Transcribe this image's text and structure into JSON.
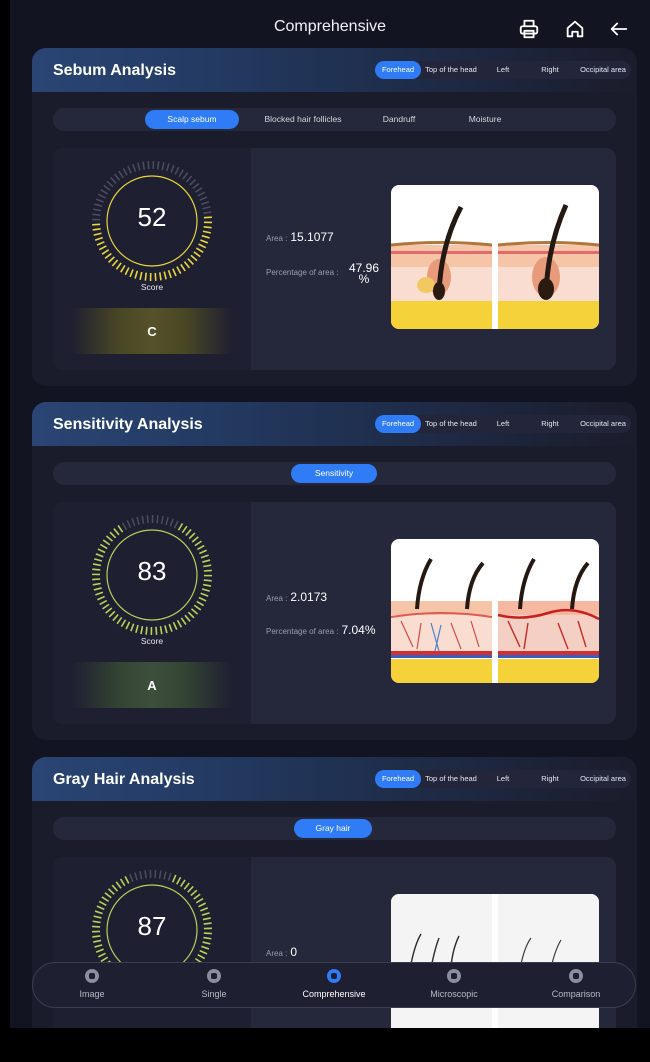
{
  "header": {
    "title": "Comprehensive",
    "print_icon": "printer-icon",
    "home_icon": "home-icon",
    "back_icon": "arrow-left-icon"
  },
  "region_tabs": [
    "Forehead",
    "Top of the head",
    "Left",
    "Right",
    "Occipital area"
  ],
  "sebum": {
    "title": "Sebum Analysis",
    "selected_region": "Forehead",
    "sub_tabs": [
      "Scalp sebum",
      "Blocked hair follicles",
      "Dandruff",
      "Moisture"
    ],
    "selected_sub_tab": "Scalp sebum",
    "score": "52",
    "score_label": "Score",
    "grade": "C",
    "area_label": "Area :",
    "area_value": "15.1077",
    "percent_label": "Percentage of area :",
    "percent_value": "47.96 %"
  },
  "sensitivity": {
    "title": "Sensitivity Analysis",
    "selected_region": "Forehead",
    "sub_tabs": [
      "Sensitivity"
    ],
    "selected_sub_tab": "Sensitivity",
    "score": "83",
    "score_label": "Score",
    "grade": "A",
    "area_label": "Area :",
    "area_value": "2.0173",
    "percent_label": "Percentage of area :",
    "percent_value": "7.04%"
  },
  "gray_hair": {
    "title": "Gray Hair Analysis",
    "selected_region": "Forehead",
    "sub_tabs": [
      "Gray hair"
    ],
    "selected_sub_tab": "Gray hair",
    "score": "87",
    "area_label": "Area :",
    "area_value": "0"
  },
  "colors": {
    "accent": "#2f7cf6",
    "background": "#131422",
    "card": "#1b1c2b",
    "gauge_yellow": "#e8d640",
    "gauge_green": "#b6d35a"
  },
  "bottom_nav": {
    "active": "Comprehensive",
    "items": [
      {
        "label": "Image",
        "icon": "image-icon"
      },
      {
        "label": "Single",
        "icon": "single-icon"
      },
      {
        "label": "Comprehensive",
        "icon": "comprehensive-icon"
      },
      {
        "label": "Microscopic",
        "icon": "microscope-icon"
      },
      {
        "label": "Comparison",
        "icon": "comparison-icon"
      }
    ]
  }
}
